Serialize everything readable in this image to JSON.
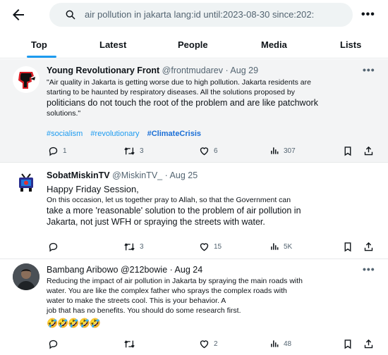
{
  "search": {
    "query": "air pollution in jakarta lang:id until:2023-08-30 since:202:"
  },
  "tabs": [
    {
      "label": "Top"
    },
    {
      "label": "Latest"
    },
    {
      "label": "People"
    },
    {
      "label": "Media"
    },
    {
      "label": "Lists"
    }
  ],
  "active_tab": "Top",
  "colors": {
    "accent": "#1d9bf0",
    "muted": "#536471",
    "text": "#0f1419"
  },
  "tweets": [
    {
      "name": "Young Revolutionary Front",
      "meta": "@frontmudarev · Aug 29",
      "lines": [
        "\"Air quality in Jakarta is getting worse due to high pollution. Jakarta residents are",
        "starting to be haunted by respiratory diseases. All the solutions proposed by",
        "politicians do not touch the root of the problem and are like patchwork",
        "solutions.\""
      ],
      "hashtags": [
        "#socialism",
        "#revolutionary",
        "#ClimateCrisis"
      ],
      "replies": "1",
      "retweets": "3",
      "likes": "6",
      "views": "307"
    },
    {
      "name": "SobatMiskinTV",
      "meta": "@MiskinTV_ · Aug 25",
      "lines": [
        "Happy Friday Session,",
        "On this occasion, let us together pray to Allah, so that the Government can",
        "take a more 'reasonable' solution to the problem of air pollution in",
        "Jakarta, not just WFH or spraying the streets with water."
      ],
      "replies": "",
      "retweets": "3",
      "likes": "15",
      "views": "5K"
    },
    {
      "name": "Bambang Aribowo",
      "meta": "@212bowie · Aug 24",
      "lines": [
        "Reducing the impact of air pollution in Jakarta by spraying the main roads with",
        "water. You are like the complex father who sprays the complex roads with",
        "water to make the streets cool. This is your behavior. A",
        "job that has no benefits. You should do some research first."
      ],
      "emoji": "🤣🤣🤣🤣🤣",
      "replies": "",
      "retweets": "",
      "likes": "2",
      "views": "48"
    }
  ]
}
